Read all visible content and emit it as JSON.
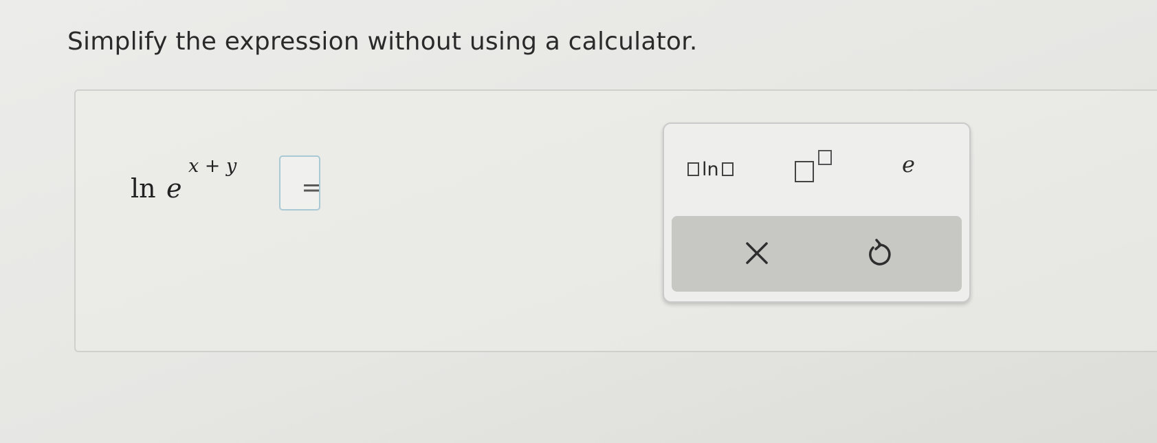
{
  "question": {
    "title": "Simplify the expression without using a calculator."
  },
  "expression": {
    "function": "ln",
    "base": "e",
    "exponent": "x + y",
    "equals": "="
  },
  "palette": {
    "buttons": [
      {
        "label": "ln",
        "icon": "log-template-icon"
      },
      {
        "icon": "power-template-icon"
      },
      {
        "label": "e",
        "icon": "e-constant"
      }
    ],
    "actions": [
      {
        "icon": "close-icon"
      },
      {
        "icon": "undo-icon"
      }
    ]
  },
  "colors": {
    "background": "#e8e8e5",
    "answer_box_border": "#a9c9d4",
    "action_bar": "#c7c7c4"
  }
}
